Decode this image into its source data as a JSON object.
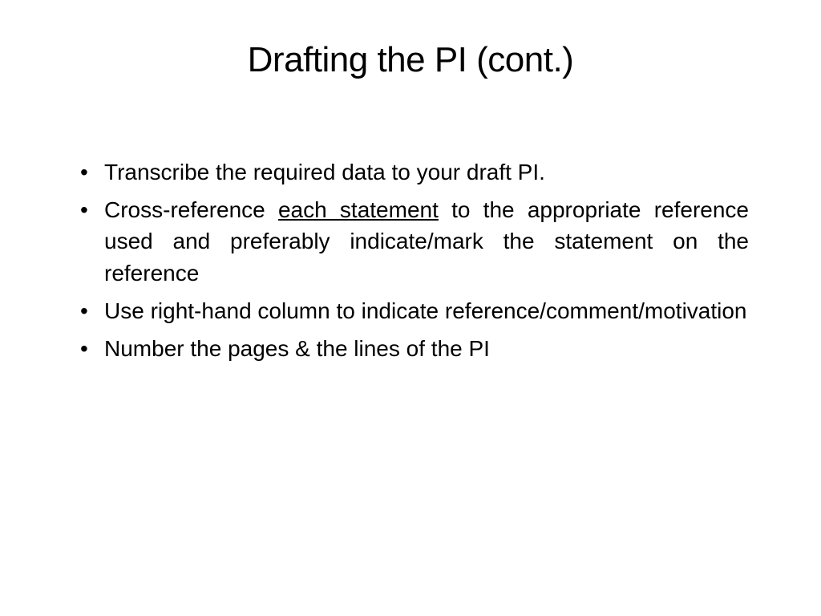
{
  "title": "Drafting the PI (cont.)",
  "bullets": [
    {
      "text": "Transcribe the required data to your draft PI."
    },
    {
      "prefix": "Cross-reference ",
      "underlined": "each statement",
      "suffix": " to the appropriate reference used and preferably indicate/mark the statement on the reference"
    },
    {
      "text": "Use right-hand column to indicate reference/comment/motivation"
    },
    {
      "text": "Number the pages & the lines of the PI"
    }
  ]
}
